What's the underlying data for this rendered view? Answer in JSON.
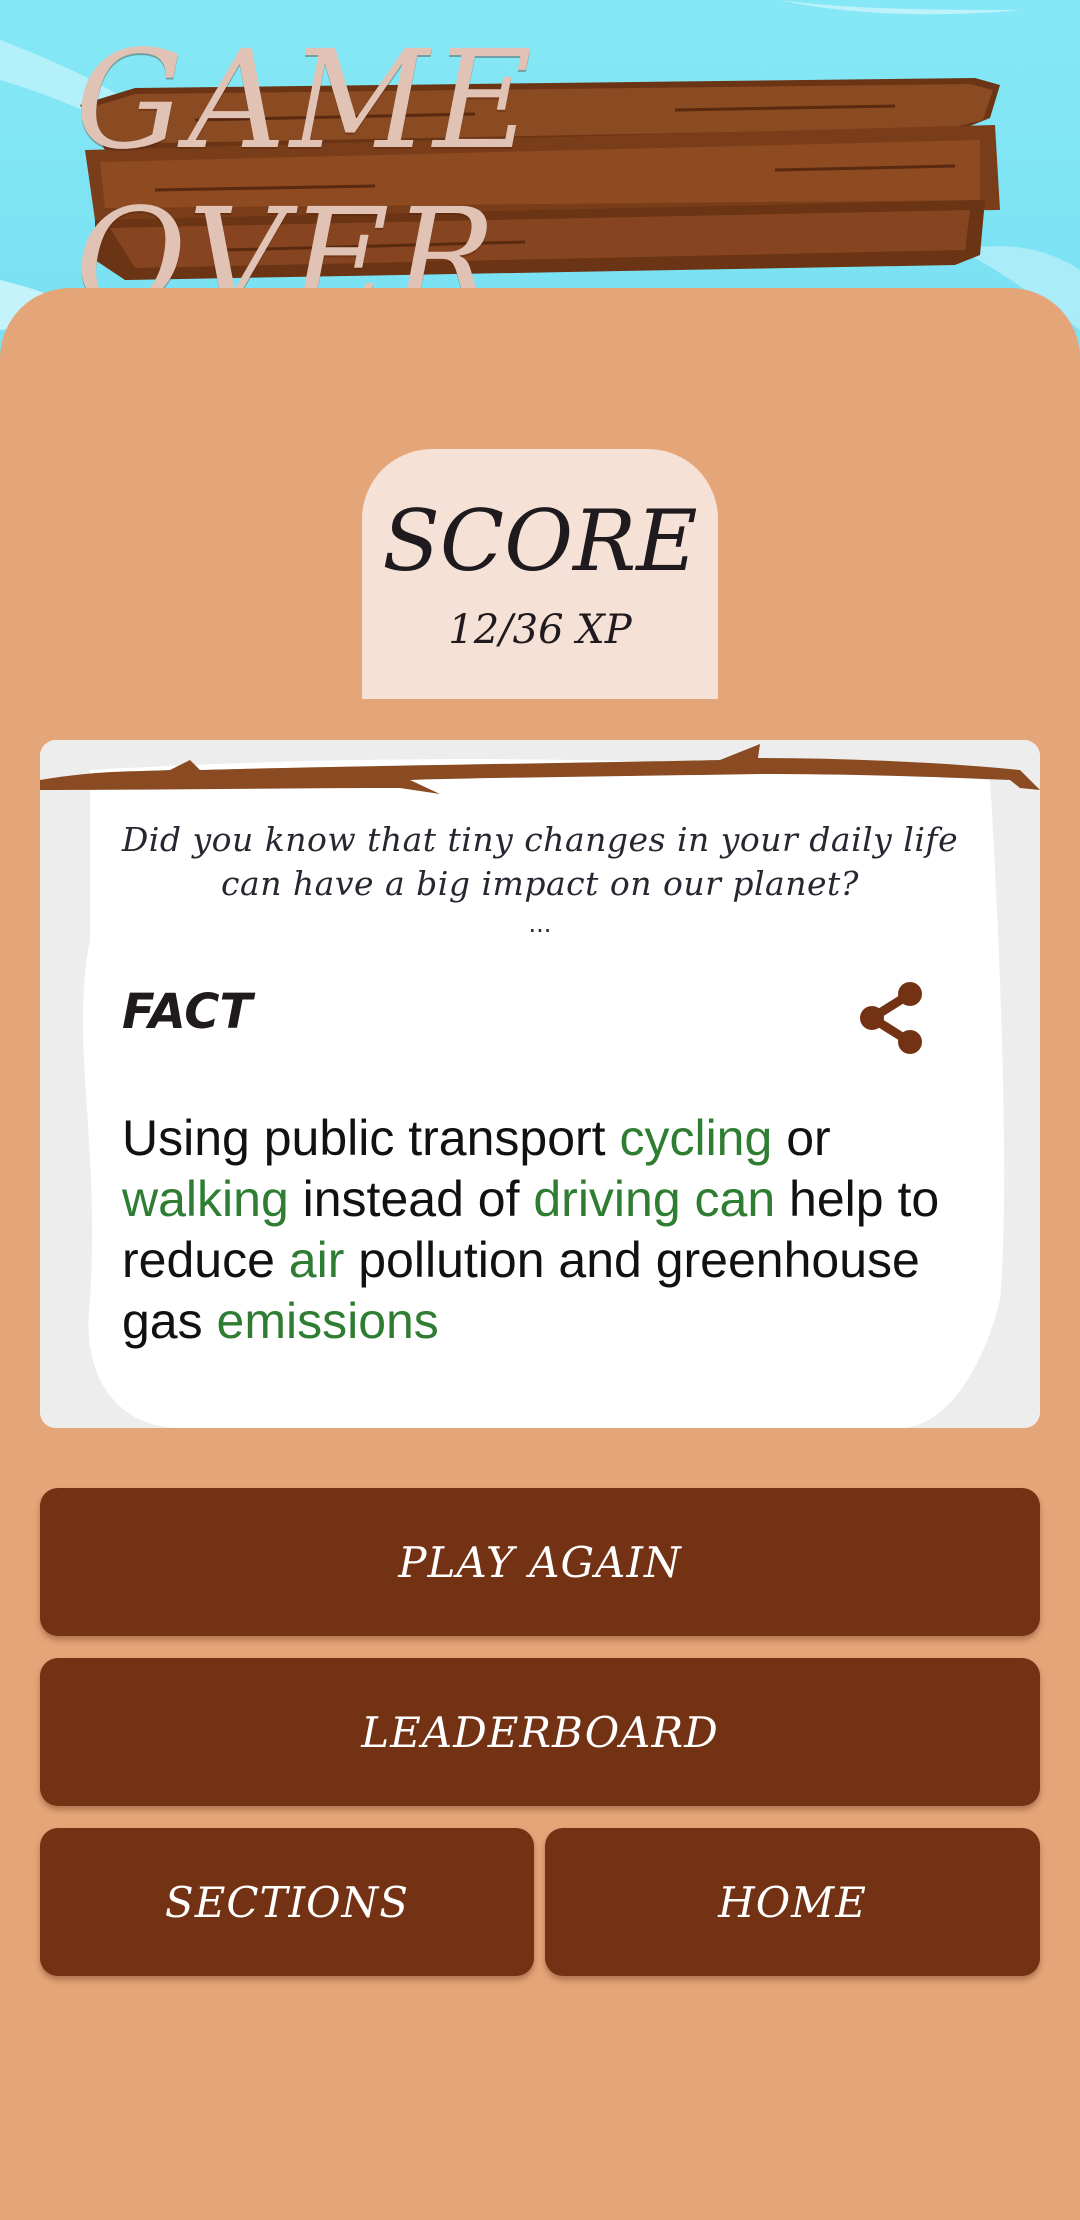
{
  "header": {
    "title": "GAME OVER"
  },
  "score": {
    "label": "SCORE",
    "value": "12/36 XP"
  },
  "fact_card": {
    "intro": "Did you know that tiny changes in your daily life can have a big impact on our planet?",
    "ellipsis": "...",
    "label": "FACT",
    "share_icon": "share-icon",
    "body_segments": [
      {
        "text": "Using public transport ",
        "highlight": false
      },
      {
        "text": "cycling",
        "highlight": true
      },
      {
        "text": " or ",
        "highlight": false
      },
      {
        "text": "walking",
        "highlight": true
      },
      {
        "text": " instead of ",
        "highlight": false
      },
      {
        "text": "driving can",
        "highlight": true
      },
      {
        "text": " help to reduce ",
        "highlight": false
      },
      {
        "text": "air",
        "highlight": true
      },
      {
        "text": " pollution and greenhouse gas ",
        "highlight": false
      },
      {
        "text": "emissions",
        "highlight": true
      }
    ]
  },
  "buttons": {
    "play_again": "PLAY AGAIN",
    "leaderboard": "LEADERBOARD",
    "sections": "SECTIONS",
    "home": "HOME"
  },
  "colors": {
    "sky": "#79e1f3",
    "panel": "#e4a578",
    "plank": "#7a3d19",
    "title_text": "#e0c3b4",
    "score_tab": "#f6e1d6",
    "button": "#743214",
    "highlight": "#2e7d32"
  }
}
